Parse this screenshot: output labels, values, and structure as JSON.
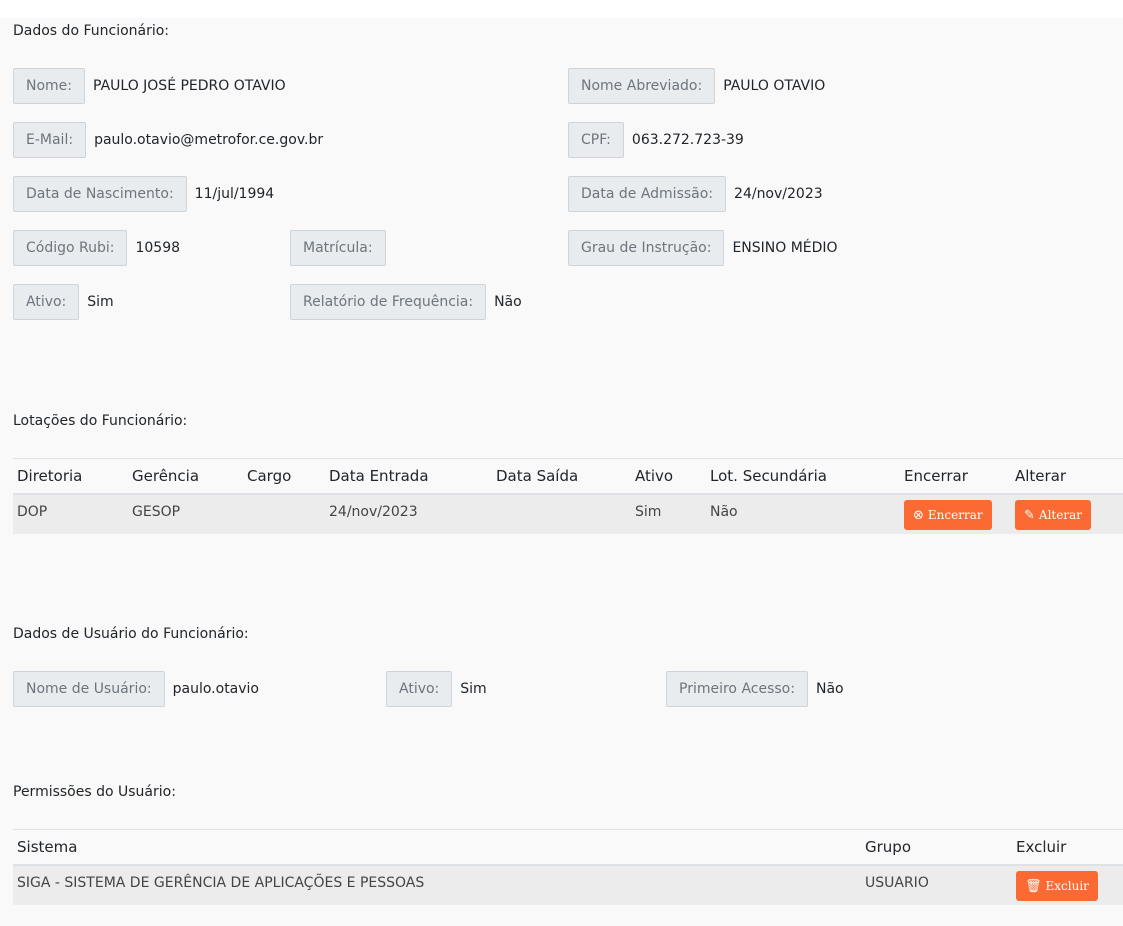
{
  "sections": {
    "employee": "Dados do Funcionário:",
    "lotacoes": "Lotações do Funcionário:",
    "user": "Dados de Usuário do Funcionário:",
    "permissions": "Permissões do Usuário:"
  },
  "employee": {
    "nome": {
      "label": "Nome:",
      "value": "PAULO JOSÉ PEDRO OTAVIO"
    },
    "nome_abreviado": {
      "label": "Nome Abreviado:",
      "value": "PAULO OTAVIO"
    },
    "email": {
      "label": "E-Mail:",
      "value": "paulo.otavio@metrofor.ce.gov.br"
    },
    "cpf": {
      "label": "CPF:",
      "value": "063.272.723-39"
    },
    "nascimento": {
      "label": "Data de Nascimento:",
      "value": "11/jul/1994"
    },
    "admissao": {
      "label": "Data de Admissão:",
      "value": "24/nov/2023"
    },
    "codigo_rubi": {
      "label": "Código Rubi:",
      "value": "10598"
    },
    "matricula": {
      "label": "Matrícula:",
      "value": ""
    },
    "grau_instrucao": {
      "label": "Grau de Instrução:",
      "value": "ENSINO MÉDIO"
    },
    "ativo": {
      "label": "Ativo:",
      "value": "Sim"
    },
    "relatorio": {
      "label": "Relatório de Frequência:",
      "value": "Não"
    }
  },
  "lotacoes": {
    "headers": [
      "Diretoria",
      "Gerência",
      "Cargo",
      "Data Entrada",
      "Data Saída",
      "Ativo",
      "Lot. Secundária",
      "Encerrar",
      "Alterar"
    ],
    "rows": [
      {
        "diretoria": "DOP",
        "gerencia": "GESOP",
        "cargo": "",
        "data_entrada": "24/nov/2023",
        "data_saida": "",
        "ativo": "Sim",
        "lot_secundaria": "Não",
        "encerrar_label": "Encerrar",
        "alterar_label": "Alterar"
      }
    ]
  },
  "user": {
    "nome_usuario": {
      "label": "Nome de Usuário:",
      "value": "paulo.otavio"
    },
    "ativo": {
      "label": "Ativo:",
      "value": "Sim"
    },
    "primeiro_acesso": {
      "label": "Primeiro Acesso:",
      "value": "Não"
    }
  },
  "permissions": {
    "headers": [
      "Sistema",
      "Grupo",
      "Excluir"
    ],
    "rows": [
      {
        "sistema": "SIGA - SISTEMA DE GERÊNCIA DE APLICAÇÕES E PESSOAS",
        "grupo": "USUARIO",
        "excluir_label": "Excluir"
      }
    ]
  },
  "icons": {
    "encerrar": "times-circle-icon",
    "alterar": "paperclip-icon",
    "excluir": "trash-icon"
  },
  "colors": {
    "button": "#fb6a32",
    "label_bg": "#e9ecef",
    "row_bg": "#ececec"
  }
}
